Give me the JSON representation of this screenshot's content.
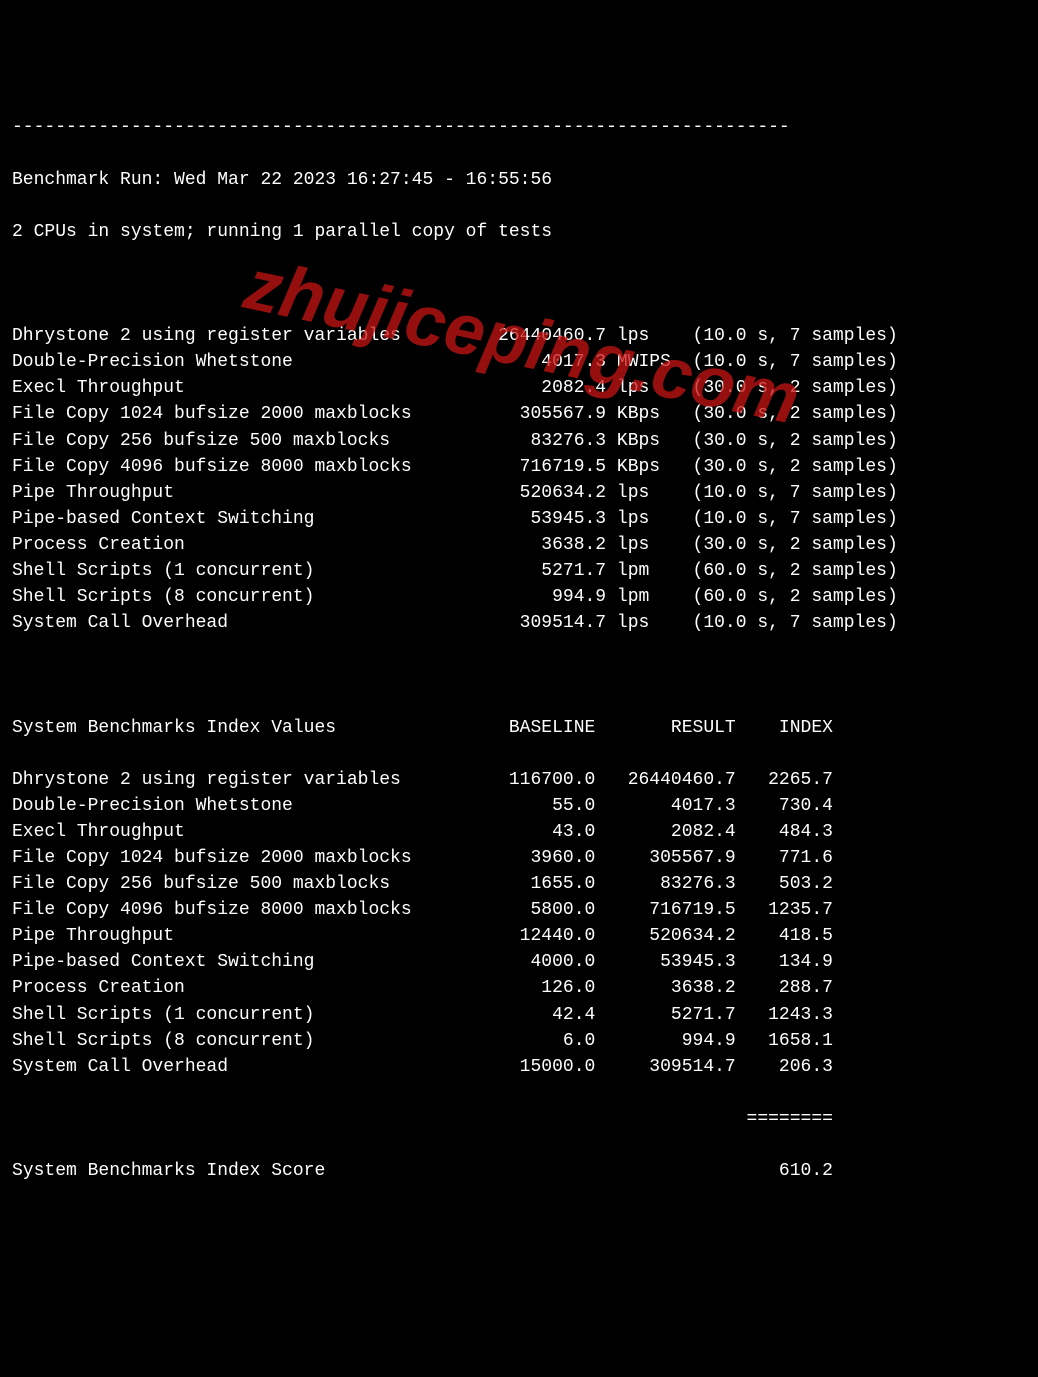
{
  "dashline": "------------------------------------------------------------------------",
  "run_line": "Benchmark Run: Wed Mar 22 2023 16:27:45 - 16:55:56",
  "cpu_line": "2 CPUs in system; running 1 parallel copy of tests",
  "tests": [
    {
      "name": "Dhrystone 2 using register variables",
      "value": "26440460.7",
      "unit": "lps",
      "time": "10.0",
      "samples": "7"
    },
    {
      "name": "Double-Precision Whetstone",
      "value": "4017.3",
      "unit": "MWIPS",
      "time": "10.0",
      "samples": "7"
    },
    {
      "name": "Execl Throughput",
      "value": "2082.4",
      "unit": "lps",
      "time": "30.0",
      "samples": "2"
    },
    {
      "name": "File Copy 1024 bufsize 2000 maxblocks",
      "value": "305567.9",
      "unit": "KBps",
      "time": "30.0",
      "samples": "2"
    },
    {
      "name": "File Copy 256 bufsize 500 maxblocks",
      "value": "83276.3",
      "unit": "KBps",
      "time": "30.0",
      "samples": "2"
    },
    {
      "name": "File Copy 4096 bufsize 8000 maxblocks",
      "value": "716719.5",
      "unit": "KBps",
      "time": "30.0",
      "samples": "2"
    },
    {
      "name": "Pipe Throughput",
      "value": "520634.2",
      "unit": "lps",
      "time": "10.0",
      "samples": "7"
    },
    {
      "name": "Pipe-based Context Switching",
      "value": "53945.3",
      "unit": "lps",
      "time": "10.0",
      "samples": "7"
    },
    {
      "name": "Process Creation",
      "value": "3638.2",
      "unit": "lps",
      "time": "30.0",
      "samples": "2"
    },
    {
      "name": "Shell Scripts (1 concurrent)",
      "value": "5271.7",
      "unit": "lpm",
      "time": "60.0",
      "samples": "2"
    },
    {
      "name": "Shell Scripts (8 concurrent)",
      "value": "994.9",
      "unit": "lpm",
      "time": "60.0",
      "samples": "2"
    },
    {
      "name": "System Call Overhead",
      "value": "309514.7",
      "unit": "lps",
      "time": "10.0",
      "samples": "7"
    }
  ],
  "index_header": {
    "title": "System Benchmarks Index Values",
    "col_baseline": "BASELINE",
    "col_result": "RESULT",
    "col_index": "INDEX"
  },
  "index_rows": [
    {
      "name": "Dhrystone 2 using register variables",
      "baseline": "116700.0",
      "result": "26440460.7",
      "index": "2265.7"
    },
    {
      "name": "Double-Precision Whetstone",
      "baseline": "55.0",
      "result": "4017.3",
      "index": "730.4"
    },
    {
      "name": "Execl Throughput",
      "baseline": "43.0",
      "result": "2082.4",
      "index": "484.3"
    },
    {
      "name": "File Copy 1024 bufsize 2000 maxblocks",
      "baseline": "3960.0",
      "result": "305567.9",
      "index": "771.6"
    },
    {
      "name": "File Copy 256 bufsize 500 maxblocks",
      "baseline": "1655.0",
      "result": "83276.3",
      "index": "503.2"
    },
    {
      "name": "File Copy 4096 bufsize 8000 maxblocks",
      "baseline": "5800.0",
      "result": "716719.5",
      "index": "1235.7"
    },
    {
      "name": "Pipe Throughput",
      "baseline": "12440.0",
      "result": "520634.2",
      "index": "418.5"
    },
    {
      "name": "Pipe-based Context Switching",
      "baseline": "4000.0",
      "result": "53945.3",
      "index": "134.9"
    },
    {
      "name": "Process Creation",
      "baseline": "126.0",
      "result": "3638.2",
      "index": "288.7"
    },
    {
      "name": "Shell Scripts (1 concurrent)",
      "baseline": "42.4",
      "result": "5271.7",
      "index": "1243.3"
    },
    {
      "name": "Shell Scripts (8 concurrent)",
      "baseline": "6.0",
      "result": "994.9",
      "index": "1658.1"
    },
    {
      "name": "System Call Overhead",
      "baseline": "15000.0",
      "result": "309514.7",
      "index": "206.3"
    }
  ],
  "separator": "========",
  "score_label": "System Benchmarks Index Score",
  "score_value": "610.2",
  "watermark": "zhujiceping.com",
  "col_widths": {
    "name": 41,
    "value": 14,
    "unit": 6,
    "baseline": 13,
    "result": 13,
    "index": 9
  }
}
